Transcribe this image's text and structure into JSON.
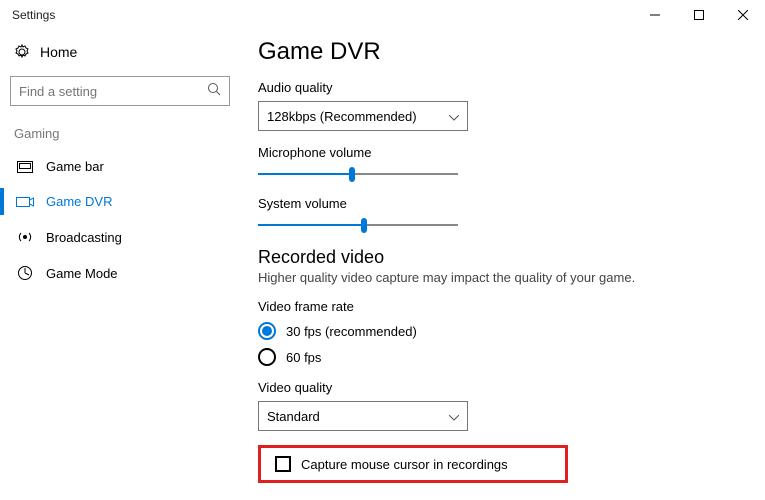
{
  "window": {
    "title": "Settings"
  },
  "sidebar": {
    "home": "Home",
    "search_placeholder": "Find a setting",
    "group": "Gaming",
    "items": [
      {
        "label": "Game bar"
      },
      {
        "label": "Game DVR"
      },
      {
        "label": "Broadcasting"
      },
      {
        "label": "Game Mode"
      }
    ]
  },
  "page": {
    "title": "Game DVR",
    "audio_quality_label": "Audio quality",
    "audio_quality_value": "128kbps (Recommended)",
    "mic_label": "Microphone volume",
    "mic_value_pct": 47,
    "sys_label": "System volume",
    "sys_value_pct": 53,
    "recorded_title": "Recorded video",
    "recorded_sub": "Higher quality video capture may impact the quality of your game.",
    "framerate_label": "Video frame rate",
    "framerate_options": [
      {
        "label": "30 fps (recommended)",
        "checked": true
      },
      {
        "label": "60 fps",
        "checked": false
      }
    ],
    "video_quality_label": "Video quality",
    "video_quality_value": "Standard",
    "capture_cursor_label": "Capture mouse cursor in recordings",
    "capture_cursor_checked": false
  }
}
